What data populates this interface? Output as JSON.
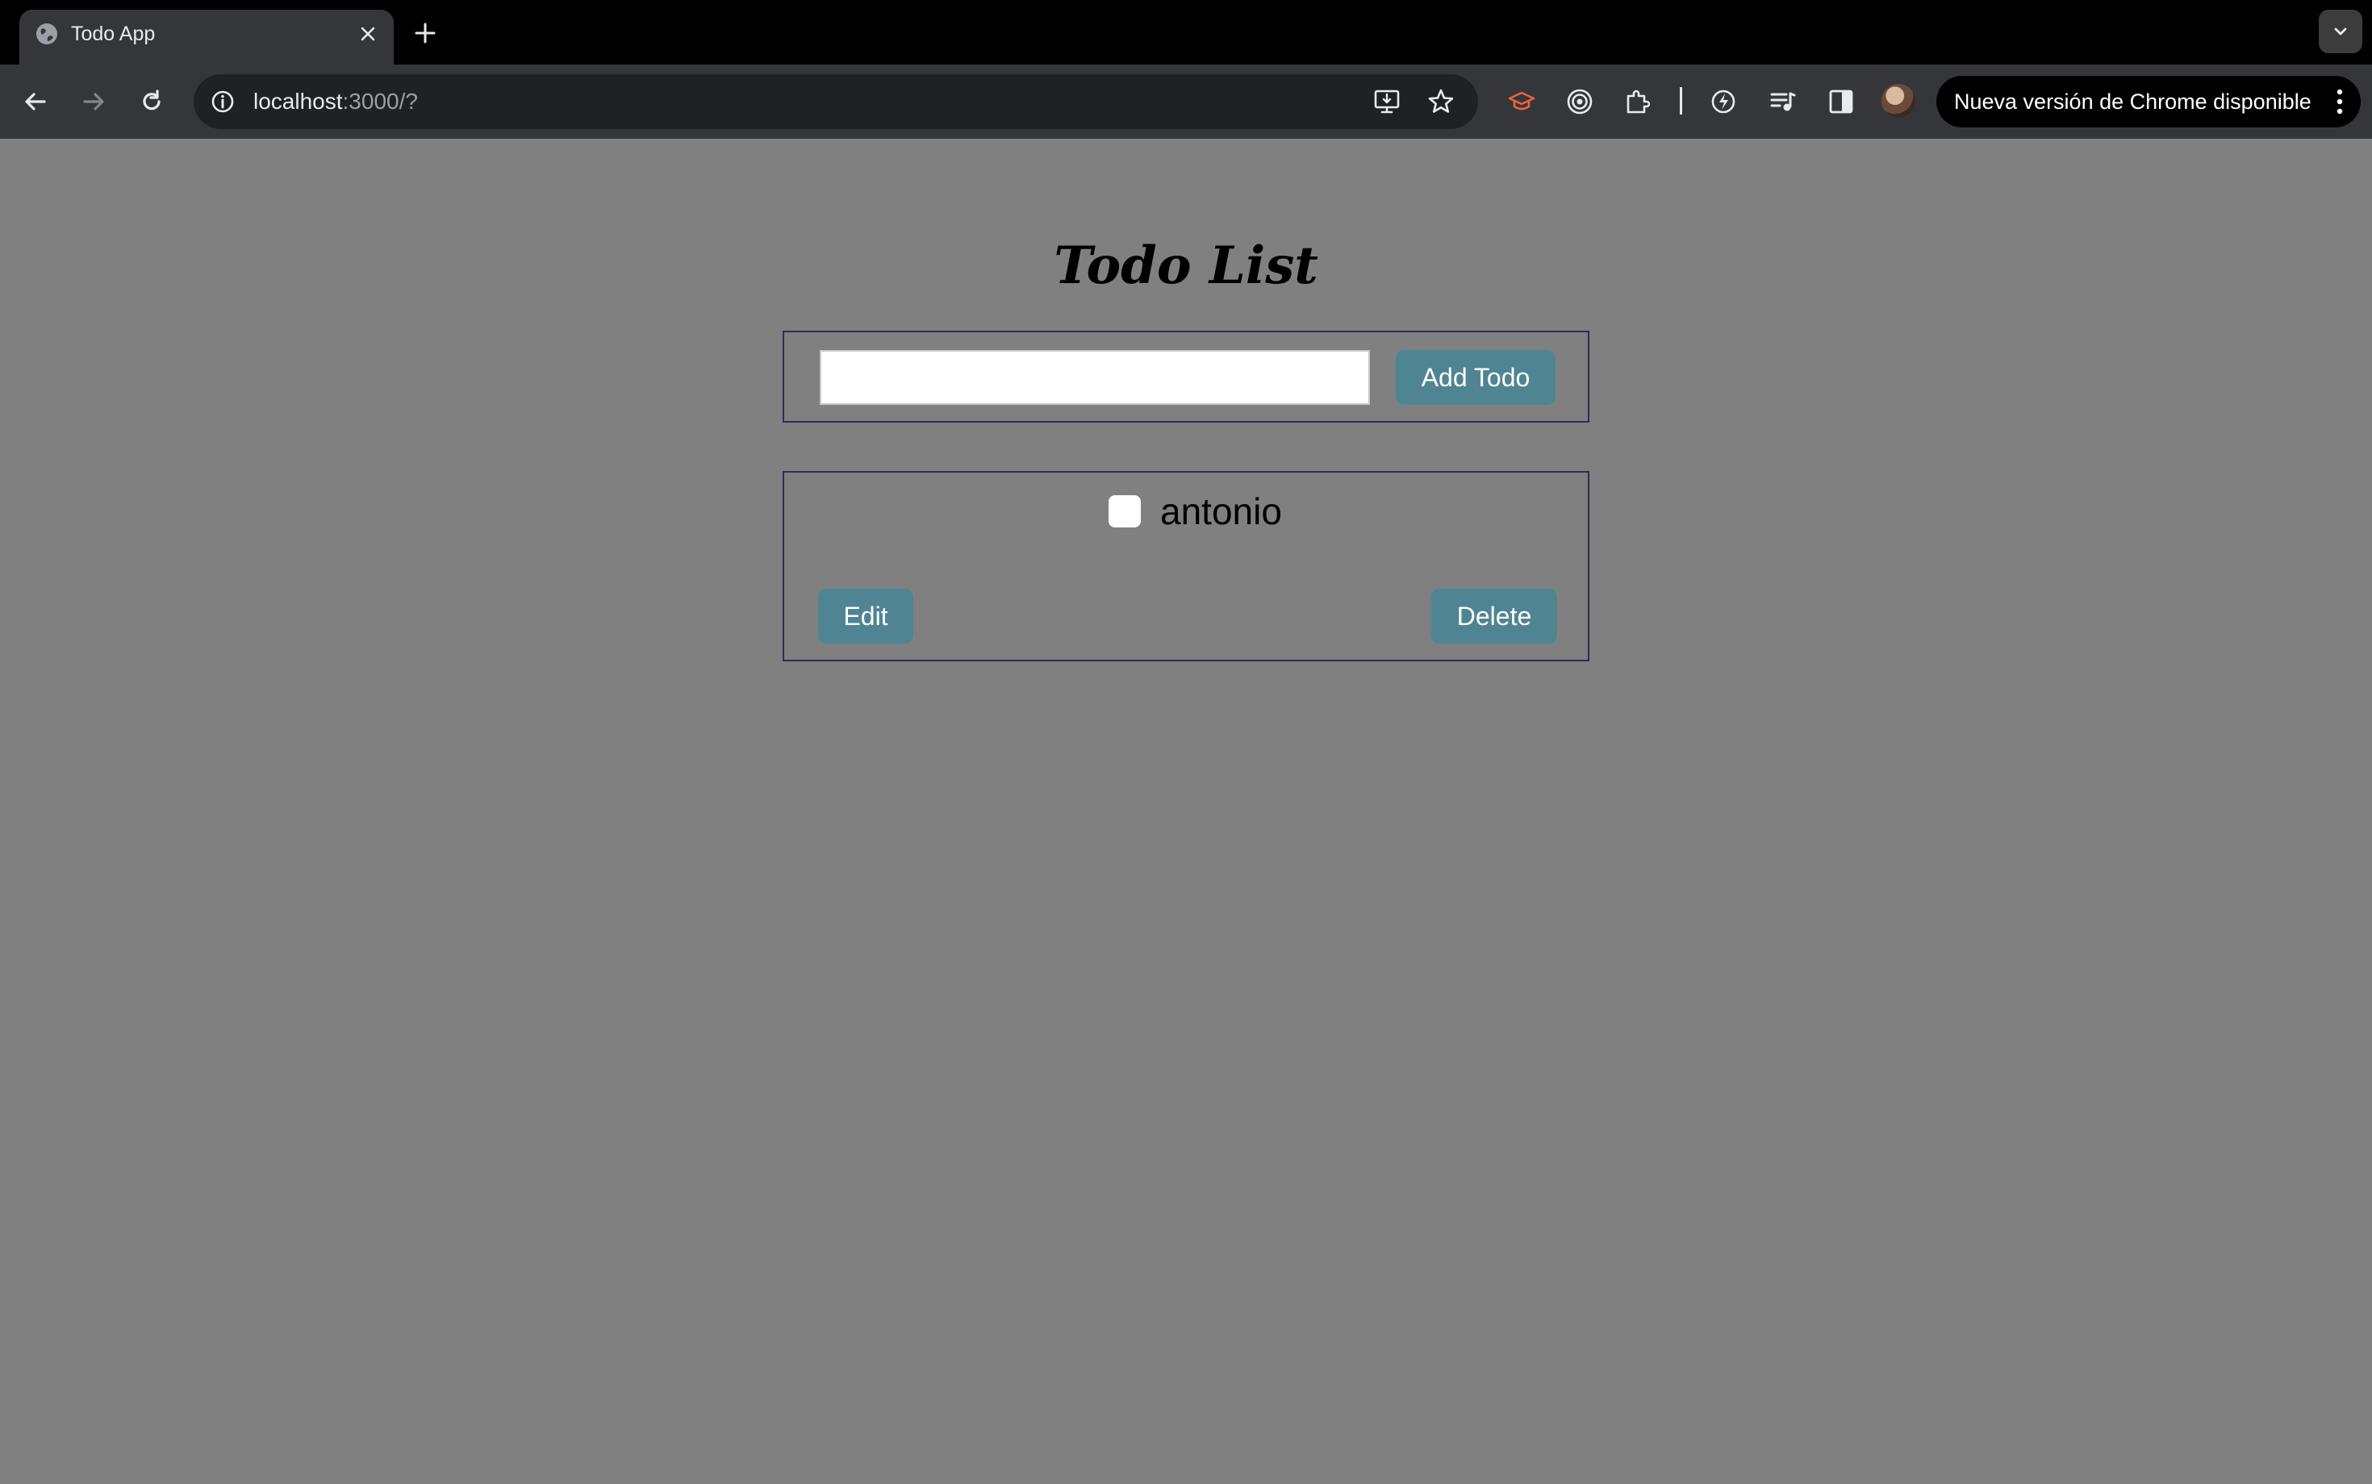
{
  "browser": {
    "tab": {
      "title": "Todo App",
      "favicon": "globe-icon"
    },
    "new_tab_icon": "plus-icon",
    "tab_search_icon": "chevron-down-icon",
    "address": {
      "host": "localhost",
      "rest": ":3000/?"
    },
    "update_label": "Nueva versión de Chrome disponible",
    "colors": {
      "tabstrip": "#000000",
      "toolbar": "#35363a",
      "omnibox": "#202124"
    }
  },
  "app": {
    "title": "Todo List",
    "input": {
      "value": "",
      "placeholder": ""
    },
    "add_button": "Add Todo",
    "todos": [
      {
        "text": "antonio",
        "completed": false,
        "edit_label": "Edit",
        "delete_label": "Delete"
      }
    ],
    "colors": {
      "background": "#808080",
      "button": "#4f8592",
      "border": "#2e2e4e"
    }
  }
}
